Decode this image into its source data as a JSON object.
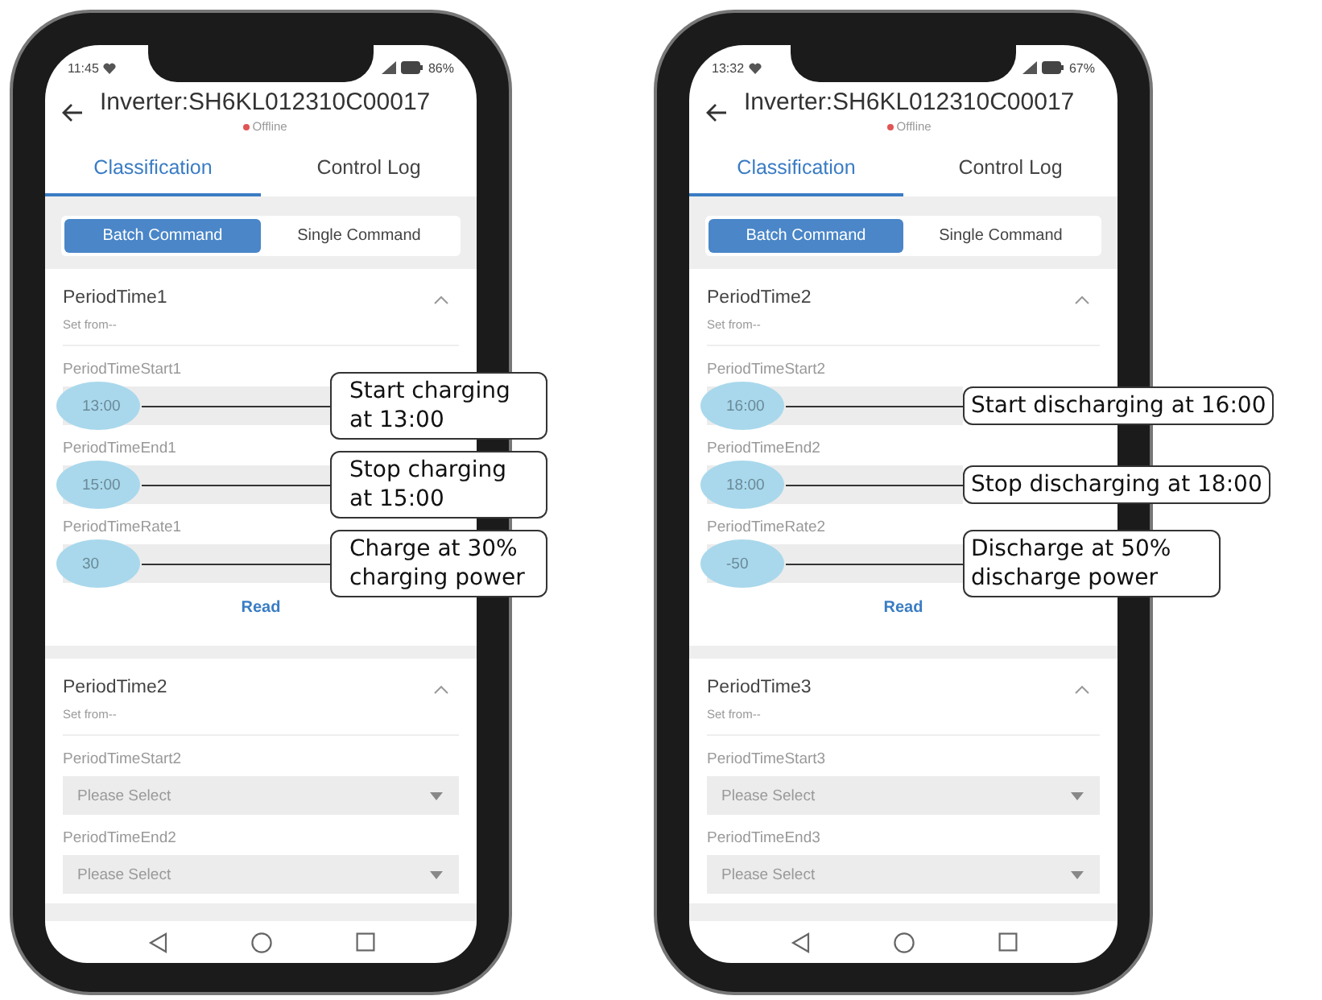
{
  "phones": [
    {
      "status_bar": {
        "time": "11:45",
        "battery": "86%"
      },
      "header": {
        "title": "Inverter:SH6KL012310C00017",
        "status": "Offline"
      },
      "tabs": [
        {
          "label": "Classification",
          "selected": true
        },
        {
          "label": "Control Log",
          "selected": false
        }
      ],
      "segments": [
        {
          "label": "Batch Command",
          "selected": true
        },
        {
          "label": "Single Command",
          "selected": false
        }
      ],
      "sections": [
        {
          "title": "PeriodTime1",
          "subtitle": "Set from--",
          "expanded": true,
          "fields": [
            {
              "kind": "input",
              "label": "PeriodTimeStart1",
              "value": "13:00",
              "callout": "Start charging at 13:00"
            },
            {
              "kind": "input",
              "label": "PeriodTimeEnd1",
              "value": "15:00",
              "callout": "Stop charging at 15:00"
            },
            {
              "kind": "input",
              "label": "PeriodTimeRate1",
              "value": "30",
              "callout": "Charge at 30% charging power"
            }
          ],
          "read_button": "Read"
        },
        {
          "title": "PeriodTime2",
          "subtitle": "Set from--",
          "expanded": true,
          "fields": [
            {
              "kind": "select",
              "label": "PeriodTimeStart2",
              "placeholder": "Please Select"
            },
            {
              "kind": "select",
              "label": "PeriodTimeEnd2",
              "placeholder": "Please Select"
            }
          ]
        }
      ]
    },
    {
      "status_bar": {
        "time": "13:32",
        "battery": "67%"
      },
      "header": {
        "title": "Inverter:SH6KL012310C00017",
        "status": "Offline"
      },
      "tabs": [
        {
          "label": "Classification",
          "selected": true
        },
        {
          "label": "Control Log",
          "selected": false
        }
      ],
      "segments": [
        {
          "label": "Batch Command",
          "selected": true
        },
        {
          "label": "Single Command",
          "selected": false
        }
      ],
      "sections": [
        {
          "title": "PeriodTime2",
          "subtitle": "Set from--",
          "expanded": true,
          "fields": [
            {
              "kind": "input",
              "label": "PeriodTimeStart2",
              "value": "16:00",
              "callout": "Start discharging at 16:00"
            },
            {
              "kind": "input",
              "label": "PeriodTimeEnd2",
              "value": "18:00",
              "callout": "Stop discharging at 18:00"
            },
            {
              "kind": "input",
              "label": "PeriodTimeRate2",
              "value": "-50",
              "callout": "Discharge at 50% discharge power"
            }
          ],
          "read_button": "Read"
        },
        {
          "title": "PeriodTime3",
          "subtitle": "Set from--",
          "expanded": true,
          "fields": [
            {
              "kind": "select",
              "label": "PeriodTimeStart3",
              "placeholder": "Please Select"
            },
            {
              "kind": "select",
              "label": "PeriodTimeEnd3",
              "placeholder": "Please Select"
            }
          ]
        }
      ]
    }
  ]
}
